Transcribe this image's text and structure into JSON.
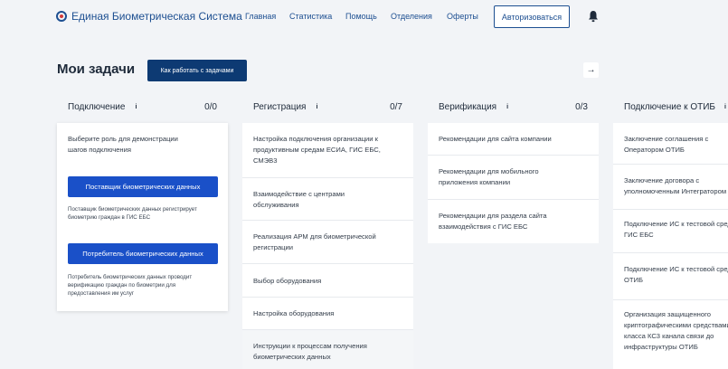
{
  "header": {
    "logo_text": "Единая Биометрическая Система",
    "nav": [
      "Главная",
      "Статистика",
      "Помощь",
      "Отделения",
      "Оферты"
    ],
    "auth_label": "Авторизоваться"
  },
  "page": {
    "title": "Мои задачи",
    "how_label": "Как работать с задачами",
    "next_arrow": "→"
  },
  "columns": [
    {
      "title": "Подключение",
      "count": "0/0",
      "intro": [
        "Выберите роль для демонстрации",
        "шагов подключения"
      ],
      "provider_button": "Поставщик биометрических данных",
      "provider_desc": [
        "Поставщик биометрических данных регистрирует",
        "биометрию граждан в ГИС ЕБС"
      ],
      "consumer_button": "Потребитель биометрических данных",
      "consumer_desc": [
        "Потребитель биометрических данных проводит",
        "верификацию граждан по биометрии для",
        "предоставления им услуг"
      ]
    },
    {
      "title": "Регистрация",
      "count": "0/7",
      "items": [
        [
          "Настройка подключения организации к",
          "продуктивным средам ЕСИА, ГИС ЕБС,",
          "СМЭВ3"
        ],
        [
          "Взаимодействие с центрами",
          "обслуживания"
        ],
        [
          "Реализация АРМ для биометрической",
          "регистрации"
        ],
        [
          "Выбор оборудования"
        ],
        [
          "Настройка оборудования"
        ],
        [
          "Инструкции к процессам получения",
          "биометрических данных"
        ]
      ]
    },
    {
      "title": "Верификация",
      "count": "0/3",
      "items": [
        [
          "Рекомендации для сайта компании"
        ],
        [
          "Рекомендации для мобильного",
          "приложения компании"
        ],
        [
          "Рекомендации для раздела сайта",
          "взаимодействия с ГИС ЕБС"
        ]
      ]
    },
    {
      "title": "Подключение к ОТИБ",
      "items": [
        [
          "Заключение соглашения с",
          "Оператором ОТИБ"
        ],
        [
          "Заключение договора с",
          "уполномоченным Интегратором"
        ],
        [
          "Подключение ИС к тестовой среде",
          "ГИС ЕБС"
        ],
        [
          "Подключение ИС к тестовой среде",
          "ОТИБ"
        ],
        [
          "Организация защищенного",
          "криптографическими средствами",
          "класса КС3 канала связи до",
          "инфраструктуры ОТИБ"
        ]
      ]
    }
  ]
}
